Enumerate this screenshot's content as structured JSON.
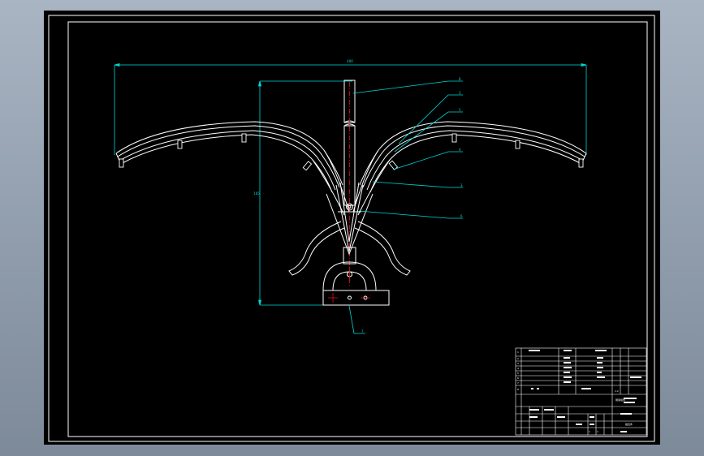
{
  "viewport": {
    "background": "#000000",
    "frame_color": "#ffffff",
    "dim_color": "#00d8d8",
    "center_color": "#e01010"
  },
  "dimensions": {
    "overall_width": "490",
    "height": "165"
  },
  "leaders": [
    "8",
    "3",
    "5",
    "4",
    "3",
    "6",
    "7"
  ],
  "title_block": {
    "rows": [
      "1",
      "2",
      "3",
      "4",
      "5",
      "6",
      "7",
      "8"
    ],
    "designation": "刷架组件",
    "scale": "1:2",
    "sheet": "1",
    "sheets": "1",
    "drawing_no": "组合件"
  }
}
